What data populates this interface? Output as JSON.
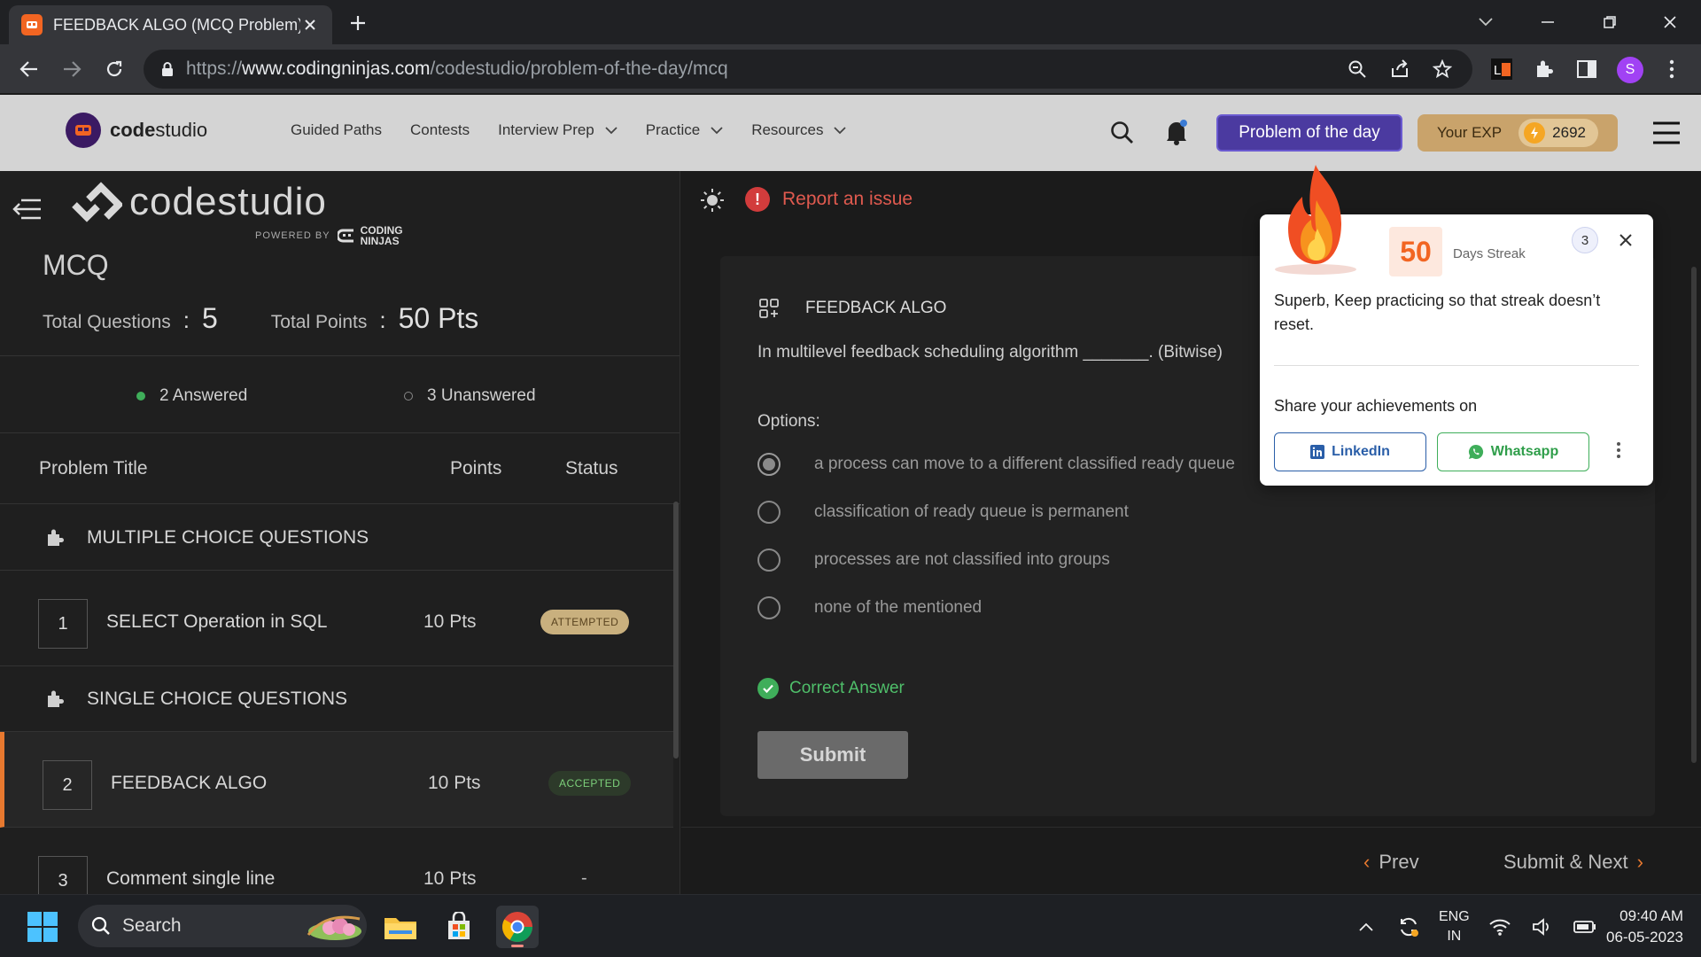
{
  "browser": {
    "tab_title": "FEEDBACK ALGO (MCQ Problem)",
    "url_prefix": "https://",
    "url_domain": "www.codingninjas.com",
    "url_path": "/codestudio/problem-of-the-day/mcq"
  },
  "site_header": {
    "brand_bold": "code",
    "brand_light": "studio",
    "nav": [
      "Guided Paths",
      "Contests",
      "Interview Prep",
      "Practice",
      "Resources"
    ],
    "potd_label": "Problem of the day",
    "exp_label": "Your EXP",
    "exp_value": "2692"
  },
  "left_panel": {
    "logo_text": "codestudio",
    "powered_by": "POWERED BY",
    "coding_ninjas": "CODING NINJAS",
    "title": "MCQ",
    "total_questions_label": "Total Questions",
    "total_questions_colon": ":",
    "total_questions": "5",
    "total_points_label": "Total Points",
    "total_points_colon": ":",
    "total_points": "50 Pts",
    "answered": "2 Answered",
    "unanswered": "3 Unanswered",
    "col_title": "Problem Title",
    "col_points": "Points",
    "col_status": "Status",
    "sections": [
      "MULTIPLE CHOICE QUESTIONS",
      "SINGLE CHOICE QUESTIONS"
    ],
    "questions": [
      {
        "num": "1",
        "title": "SELECT Operation in SQL",
        "points": "10 Pts",
        "status": "ATTEMPTED"
      },
      {
        "num": "2",
        "title": "FEEDBACK ALGO",
        "points": "10 Pts",
        "status": "ACCEPTED"
      },
      {
        "num": "3",
        "title": "Comment single line",
        "points": "10 Pts",
        "status": "-"
      }
    ]
  },
  "question": {
    "report": "Report an issue",
    "title": "FEEDBACK ALGO",
    "text": "In multilevel feedback scheduling algorithm _______. (Bitwise)",
    "options_label": "Options:",
    "options": [
      "a process can move to a different classified ready queue",
      "classification of ready queue is permanent",
      "processes are not classified into groups",
      "none of the mentioned"
    ],
    "selected_option_index": 0,
    "result": "Correct Answer",
    "submit": "Submit",
    "prev": "Prev",
    "next": "Submit & Next"
  },
  "streak_popup": {
    "days": "50",
    "days_label": "Days Streak",
    "count": "3",
    "message": "Superb, Keep practicing so that streak doesn’t reset.",
    "share_label": "Share your achievements on",
    "linkedin": "LinkedIn",
    "whatsapp": "Whatsapp"
  },
  "taskbar": {
    "search": "Search",
    "lang_top": "ENG",
    "lang_bottom": "IN",
    "time": "09:40 AM",
    "date": "06-05-2023"
  },
  "colors": {
    "accent_orange": "#e8792f",
    "potd_purple": "#4b3aa0",
    "correct_green": "#3fae5a",
    "report_red": "#d23c3c"
  },
  "icons": [
    "back-arrow-icon",
    "forward-arrow-icon",
    "reload-icon",
    "lock-icon",
    "zoom-icon",
    "share-icon",
    "star-icon",
    "puzzle-icon",
    "sidebar-icon",
    "search-icon",
    "bell-icon",
    "coin-icon",
    "menu-icon",
    "sun-icon",
    "alert-icon",
    "grid-icon",
    "flame-icon",
    "close-icon",
    "linkedin-icon",
    "whatsapp-icon",
    "more-icon",
    "windows-icon",
    "folder-icon",
    "store-icon",
    "chrome-icon",
    "wifi-icon",
    "volume-icon",
    "battery-icon"
  ]
}
